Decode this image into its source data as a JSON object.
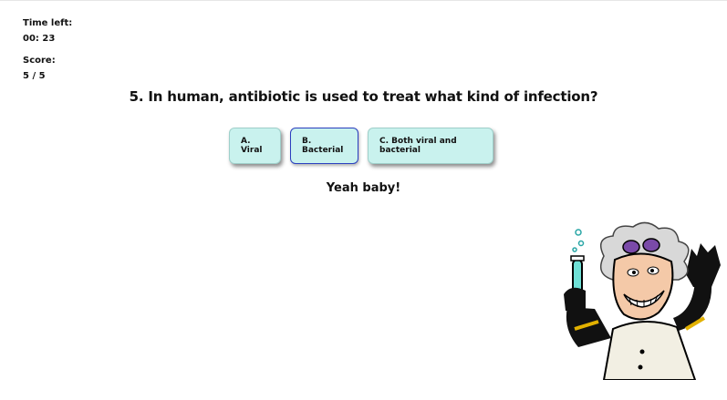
{
  "stats": {
    "time_label": "Time left:",
    "time_value": "00: 23",
    "score_label": "Score:",
    "score_value": "5 / 5"
  },
  "question": {
    "text": "5. In human, antibiotic is used to treat what kind of infection?"
  },
  "answers": [
    {
      "label": "A. Viral",
      "selected": false
    },
    {
      "label": "B. Bacterial",
      "selected": true
    },
    {
      "label": "C. Both viral and bacterial",
      "selected": false
    }
  ],
  "feedback": {
    "text": "Yeah baby!"
  },
  "colors": {
    "answer_bg": "#c9f2ee",
    "selected_border": "#2b3fbf"
  },
  "illustration": {
    "icon": "mad-scientist-icon"
  }
}
